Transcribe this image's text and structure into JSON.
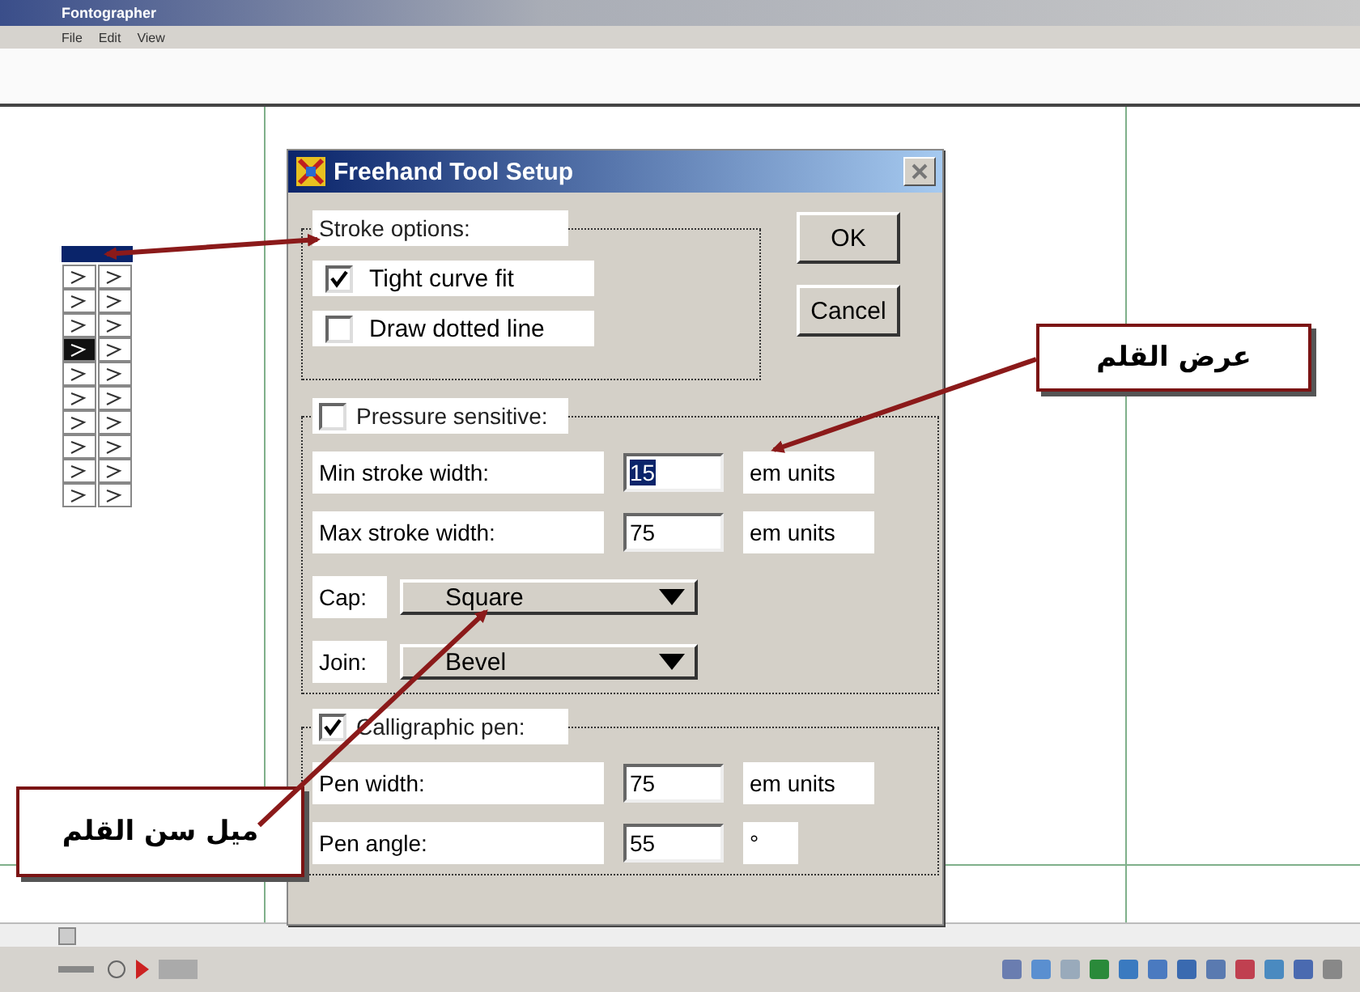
{
  "app": {
    "title": "Fontographer",
    "menu": [
      "File",
      "Edit",
      "View"
    ]
  },
  "dialog": {
    "title": "Freehand Tool Setup",
    "stroke_options": {
      "label": "Stroke options:",
      "options": [
        {
          "label": "Tight curve fit",
          "checked": true
        },
        {
          "label": "Draw dotted line",
          "checked": false
        }
      ]
    },
    "buttons": [
      "OK",
      "Cancel"
    ],
    "pressure": {
      "label": "Pressure sensitive:",
      "checked": false,
      "rows": [
        {
          "label": "Min stroke width:",
          "value": "15",
          "selected": true,
          "unit": "em units"
        },
        {
          "label": "Max stroke width:",
          "value": "75",
          "selected": false,
          "unit": "em units"
        }
      ],
      "dropdowns": [
        {
          "label": "Cap:",
          "value": "Square"
        },
        {
          "label": "Join:",
          "value": "Bevel"
        }
      ]
    },
    "calligraphic": {
      "label": "Calligraphic pen:",
      "checked": true,
      "rows": [
        {
          "label": "Pen width:",
          "value": "75",
          "selected": false,
          "unit": "em units"
        },
        {
          "label": "Pen angle:",
          "value": "55",
          "selected": false,
          "unit": "°"
        }
      ]
    }
  },
  "annotations": [
    {
      "text": "عرض القلم"
    },
    {
      "text": "ميل سن القلم"
    }
  ]
}
